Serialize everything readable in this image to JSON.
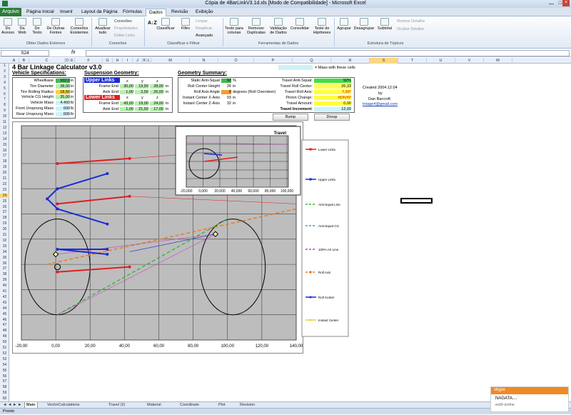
{
  "window": {
    "title": "Cópia de 4BarLinkV3.1d.xls  [Modo de Compatibilidade]  -  Microsoft Excel"
  },
  "tabs": {
    "file": "Arquivo",
    "items": [
      "Página Inicial",
      "Inserir",
      "Layout da Página",
      "Fórmulas",
      "Dados",
      "Revisão",
      "Exibição"
    ]
  },
  "ribbon": {
    "acesso": "Do\nAcesso",
    "web": "Da\nWeb",
    "texto": "De\nTexto",
    "outras": "De Outras\nFontes",
    "existentes": "Conexões\nExistentes",
    "atualizar": "Atualizar\ntudo",
    "conexoes": "Conexões",
    "propriedades": "Propriedades",
    "editar_links": "Editar Links",
    "classificar": "Classificar",
    "filtro": "Filtro",
    "limpar": "Limpar",
    "reaplicar": "Reaplicar",
    "avancado": "Avançado",
    "texto_colunas": "Texto para\ncolunas",
    "remover_dup": "Remover\nDuplicatas",
    "validacao": "Validação\nde Dados",
    "consolidar": "Consolidar",
    "teste": "Teste de\nHipóteses",
    "agrupar": "Agrupar",
    "desagrupar": "Desagrupar",
    "subtotal": "Subtotal",
    "mostrar": "Mostrar Detalhe",
    "ocultar": "Ocultar Detalhe",
    "g1": "Obter Dados Externos",
    "g2": "Conexões",
    "g3": "Classificar e Filtrar",
    "g4": "Ferramentas de Dados",
    "g5": "Estrutura de Tópicos"
  },
  "formula": {
    "namebox": "S24",
    "fx": "fx",
    "value": ""
  },
  "columns": [
    "A",
    "B",
    "C",
    "D",
    "E",
    "F",
    "G",
    "H",
    "I",
    "J",
    "K",
    "L",
    "M",
    "N",
    "O",
    "P",
    "Q",
    "R",
    "S",
    "T",
    "U",
    "V",
    "W"
  ],
  "sheet": {
    "title": "4 Bar Linkage Calculator v3.0",
    "mass_note": "= Mass with these cells",
    "vehicle_header": "Vehicle Specifications:",
    "vehicle": [
      {
        "label": "Wheelbase",
        "value": "102,0",
        "unit": "in"
      },
      {
        "label": "Tire Diameter",
        "value": "38,00",
        "unit": "in"
      },
      {
        "label": "Tire Rolling Radius",
        "value": "18,50",
        "unit": "in"
      },
      {
        "label": "Vehicle CG Height",
        "value": "35,00",
        "unit": "in"
      },
      {
        "label": "Vehicle Mass",
        "value": "4.400",
        "unit": "lb"
      },
      {
        "label": "Front Unsprung Mass",
        "value": "600",
        "unit": "lb"
      },
      {
        "label": "Rear Unsprung Mass",
        "value": "600",
        "unit": "lb"
      }
    ],
    "susp_header": "Suspension Geometry:",
    "upper_links": "Upper Links",
    "lower_links": "Lower Links",
    "xyz": [
      "x",
      "y",
      "z"
    ],
    "upper": [
      {
        "label": "Frame End",
        "x": "30,00",
        "y": "13,50",
        "z": "28,00"
      },
      {
        "label": "Axle End",
        "x": "1,00",
        "y": "2,50",
        "z": "26,00"
      }
    ],
    "lower": [
      {
        "label": "Frame End",
        "x": "43,00",
        "y": "19,00",
        "z": "24,00"
      },
      {
        "label": "Axle End",
        "x": "1,00",
        "y": "21,50",
        "z": "17,00"
      }
    ],
    "geo_header": "Geometry Summary:",
    "geo": [
      {
        "label": "Static Anti-Squat",
        "value": "92",
        "unit": "%"
      },
      {
        "label": "Roll Center Height",
        "value": "26",
        "unit": "in"
      },
      {
        "label": "Roll Axis Angle",
        "value": "8",
        "unit": "degrees (Roll Oversteer)"
      },
      {
        "label": "Instant Center X-Axis",
        "value": "93",
        "unit": "in"
      },
      {
        "label": "Instant Center Z-Axis",
        "value": "32",
        "unit": "in"
      }
    ],
    "travel": [
      {
        "label": "Travel Anti-Squat:",
        "value": "92%"
      },
      {
        "label": "Travel Roll Center:",
        "value": "26,33"
      },
      {
        "label": "Travel Roll Axis:",
        "value": "7,99°"
      },
      {
        "label": "Pinion Change:",
        "value": "#DIV/0!"
      },
      {
        "label": "Travel Amount:",
        "value": "0,00"
      },
      {
        "label": "Travel Increment:",
        "value": "12,00"
      }
    ],
    "created": "Created 2004.12.04",
    "by": "by",
    "author": "Dan Barcroft",
    "email": "tntage4@gmail.com",
    "bump": "Bump",
    "droop": "Droop"
  },
  "chart_data": {
    "type": "scatter",
    "x_ticks": [
      "-20,00",
      "0,00",
      "20,00",
      "40,00",
      "60,00",
      "80,00",
      "100,00",
      "120,00",
      "140,00"
    ],
    "xlim": [
      -20,
      140
    ],
    "ylim": [
      -10,
      75
    ],
    "series": [
      {
        "name": "Lower Links",
        "color": "#e02020",
        "points": [
          [
            1,
            17
          ],
          [
            43,
            19
          ],
          [
            1,
            60
          ],
          [
            43,
            62
          ],
          [
            1,
            21.5
          ],
          [
            43,
            19
          ]
        ]
      },
      {
        "name": "Upper Links",
        "color": "#1a2bd6",
        "points": [
          [
            30,
            13.5
          ],
          [
            1,
            2.5
          ],
          [
            -5,
            8
          ],
          [
            1,
            2.5
          ],
          [
            30,
            26
          ]
        ]
      },
      {
        "name": "Anti-Squat Line",
        "color": "#2db52d"
      },
      {
        "name": "Anti-Squat CG",
        "color": "#2aa6c4"
      },
      {
        "name": "100% AS Line",
        "color": "#c33bc0"
      },
      {
        "name": "Roll Axis",
        "color": "#f07a1a"
      },
      {
        "name": "Roll Center",
        "color": "#1a2bd6"
      },
      {
        "name": "Instant Center",
        "color": "#e8d040"
      }
    ],
    "inset": {
      "title": "Travel",
      "x_ticks": [
        "-20,000",
        "0,000",
        "20,000",
        "40,000",
        "60,000",
        "80,000",
        "100,000"
      ]
    }
  },
  "sheet_tabs": [
    "Main",
    "VectorCalculations",
    "Travel (2)",
    "Material",
    "Coordinate",
    "Plot",
    "Revision"
  ],
  "status": "Pronto",
  "skype": {
    "brand": "skype",
    "name": "NAGATA....",
    "status": "est9-online"
  }
}
